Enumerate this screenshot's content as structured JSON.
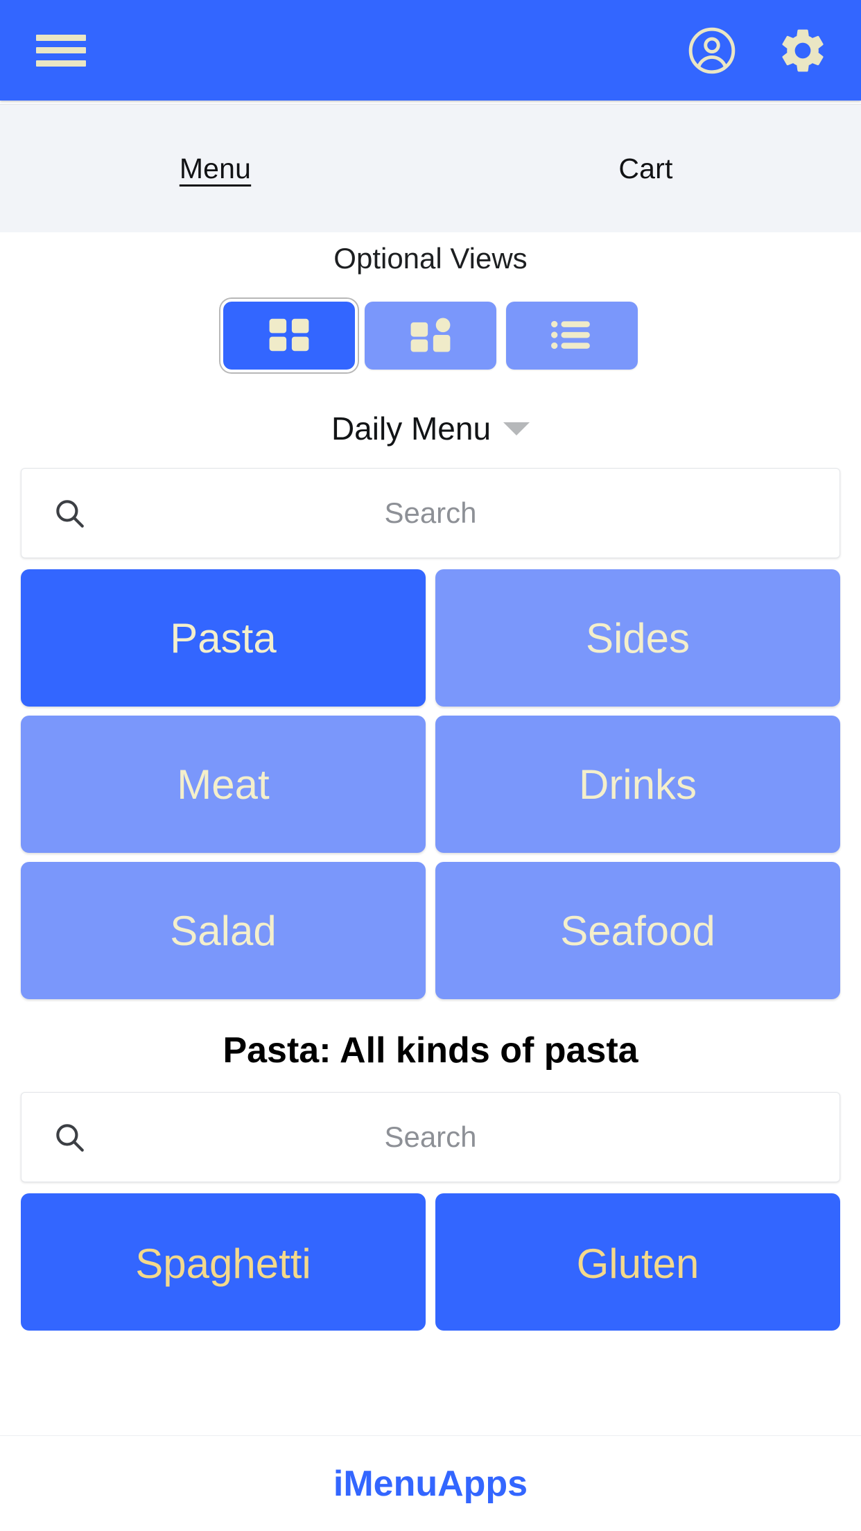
{
  "appbar": {
    "menu_icon": "hamburger-icon",
    "account_icon": "account-circle-icon",
    "settings_icon": "gear-icon",
    "background_color": "#3366FF",
    "icon_color": "#EAE6C4"
  },
  "tabs": [
    {
      "label": "Menu",
      "active": true
    },
    {
      "label": "Cart",
      "active": false
    }
  ],
  "optional_views": {
    "label": "Optional Views",
    "buttons": [
      {
        "icon": "grid-view-icon",
        "selected": true
      },
      {
        "icon": "mixed-grid-view-icon",
        "selected": false
      },
      {
        "icon": "list-view-icon",
        "selected": false
      }
    ]
  },
  "daily_menu": {
    "label": "Daily Menu",
    "caret_icon": "chevron-down-icon"
  },
  "category_search": {
    "placeholder": "Search",
    "value": "",
    "icon": "search-icon"
  },
  "categories": [
    {
      "label": "Pasta",
      "selected": true
    },
    {
      "label": "Sides",
      "selected": false
    },
    {
      "label": "Meat",
      "selected": false
    },
    {
      "label": "Drinks",
      "selected": false
    },
    {
      "label": "Salad",
      "selected": false
    },
    {
      "label": "Seafood",
      "selected": false
    }
  ],
  "section": {
    "title": "Pasta: All kinds of pasta"
  },
  "item_search": {
    "placeholder": "Search",
    "value": "",
    "icon": "search-icon"
  },
  "items": [
    {
      "label": "Spaghetti"
    },
    {
      "label": "Gluten"
    }
  ],
  "footer": {
    "brand": "iMenuApps",
    "brand_color": "#3366FF"
  },
  "colors": {
    "primary_blue": "#3366FF",
    "light_blue": "#7A97FB",
    "cream": "#F4EFCB",
    "tab_bar_bg": "#F2F4F8"
  }
}
